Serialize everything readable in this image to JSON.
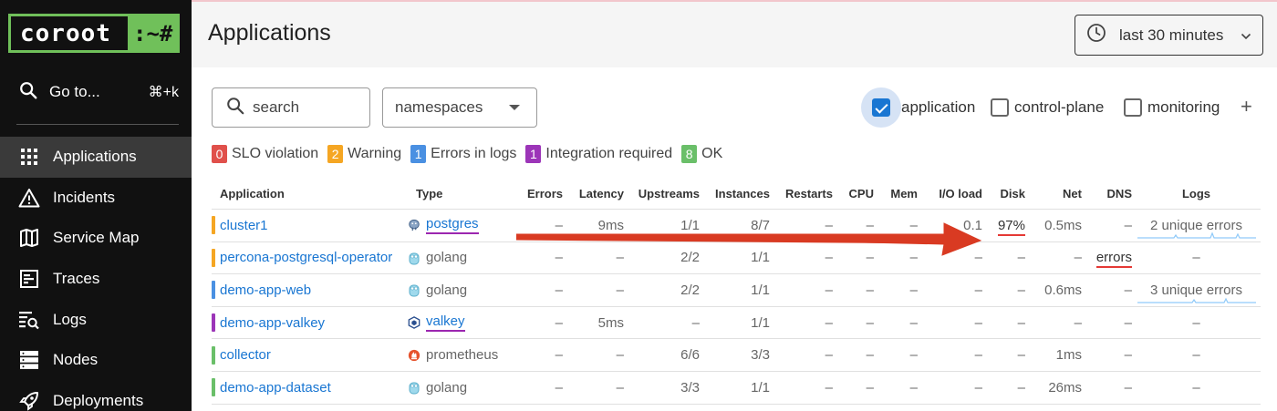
{
  "logo": {
    "part1": "coroot",
    "part2": ":~#"
  },
  "goto": {
    "label": "Go to...",
    "shortcut": "⌘+k"
  },
  "nav": [
    {
      "label": "Applications",
      "icon": "grid-icon",
      "active": true
    },
    {
      "label": "Incidents",
      "icon": "warning-icon"
    },
    {
      "label": "Service Map",
      "icon": "map-icon"
    },
    {
      "label": "Traces",
      "icon": "traces-icon"
    },
    {
      "label": "Logs",
      "icon": "logs-icon"
    },
    {
      "label": "Nodes",
      "icon": "server-icon"
    },
    {
      "label": "Deployments",
      "icon": "rocket-icon"
    }
  ],
  "header": {
    "title": "Applications",
    "time_range": "last 30 minutes"
  },
  "filters": {
    "search_placeholder": "search",
    "namespaces": "namespaces",
    "categories": [
      {
        "label": "application",
        "checked": true
      },
      {
        "label": "control-plane",
        "checked": false
      },
      {
        "label": "monitoring",
        "checked": false
      }
    ],
    "add": "+"
  },
  "legend": [
    {
      "count": "0",
      "label": "SLO violation",
      "color": "#e0504b"
    },
    {
      "count": "2",
      "label": "Warning",
      "color": "#f5a623"
    },
    {
      "count": "1",
      "label": "Errors in logs",
      "color": "#4a90e2"
    },
    {
      "count": "1",
      "label": "Integration required",
      "color": "#9c35b8"
    },
    {
      "count": "8",
      "label": "OK",
      "color": "#6abf69"
    }
  ],
  "table": {
    "columns": [
      "Application",
      "Type",
      "Errors",
      "Latency",
      "Upstreams",
      "Instances",
      "Restarts",
      "CPU",
      "Mem",
      "I/O load",
      "Disk",
      "Net",
      "DNS",
      "Logs"
    ],
    "rows": [
      {
        "status": "#f5a623",
        "app": "cluster1",
        "type": "postgres",
        "type_icon": "postgres-icon",
        "type_link": true,
        "errors": "–",
        "latency": "9ms",
        "upstreams": "1/1",
        "instances": "8/7",
        "restarts": "–",
        "cpu": "–",
        "mem": "–",
        "io": "0.1",
        "disk": "97%",
        "net": "0.5ms",
        "dns": "–",
        "logs": "2 unique errors"
      },
      {
        "status": "#f5a623",
        "app": "percona-postgresql-operator",
        "type": "golang",
        "type_icon": "golang-icon",
        "type_link": false,
        "errors": "–",
        "latency": "–",
        "upstreams": "2/2",
        "instances": "1/1",
        "restarts": "–",
        "cpu": "–",
        "mem": "–",
        "io": "–",
        "disk": "–",
        "net": "–",
        "dns": "errors",
        "logs": "–"
      },
      {
        "status": "#4a90e2",
        "app": "demo-app-web",
        "type": "golang",
        "type_icon": "golang-icon",
        "type_link": false,
        "errors": "–",
        "latency": "–",
        "upstreams": "2/2",
        "instances": "1/1",
        "restarts": "–",
        "cpu": "–",
        "mem": "–",
        "io": "–",
        "disk": "–",
        "net": "0.6ms",
        "dns": "–",
        "logs": "3 unique errors"
      },
      {
        "status": "#9c35b8",
        "app": "demo-app-valkey",
        "type": "valkey",
        "type_icon": "valkey-icon",
        "type_link": true,
        "errors": "–",
        "latency": "5ms",
        "upstreams": "–",
        "instances": "1/1",
        "restarts": "–",
        "cpu": "–",
        "mem": "–",
        "io": "–",
        "disk": "–",
        "net": "–",
        "dns": "–",
        "logs": "–"
      },
      {
        "status": "#6abf69",
        "app": "collector",
        "type": "prometheus",
        "type_icon": "prometheus-icon",
        "type_link": false,
        "errors": "–",
        "latency": "–",
        "upstreams": "6/6",
        "instances": "3/3",
        "restarts": "–",
        "cpu": "–",
        "mem": "–",
        "io": "–",
        "disk": "–",
        "net": "1ms",
        "dns": "–",
        "logs": "–"
      },
      {
        "status": "#6abf69",
        "app": "demo-app-dataset",
        "type": "golang",
        "type_icon": "golang-icon",
        "type_link": false,
        "errors": "–",
        "latency": "–",
        "upstreams": "3/3",
        "instances": "1/1",
        "restarts": "–",
        "cpu": "–",
        "mem": "–",
        "io": "–",
        "disk": "–",
        "net": "26ms",
        "dns": "–",
        "logs": "–"
      }
    ]
  }
}
